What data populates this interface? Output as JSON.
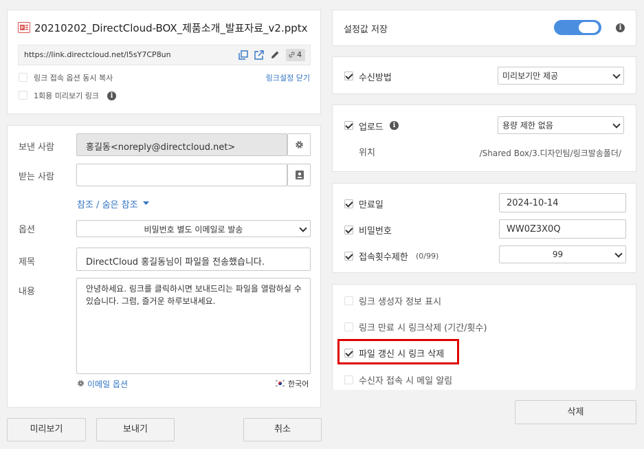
{
  "file": {
    "name": "20210202_DirectCloud-BOX_제품소개_발표자료_v2.pptx",
    "icon": "pptx-file-icon",
    "link_url": "https://link.directcloud.net/l5sY7CP8un",
    "link_count": "4",
    "copy_with_options_label": "링크 접속 옵션 동시 복사",
    "close_link_settings_label": "링크설정 닫기",
    "one_time_preview_label": "1회용 미리보기 링크"
  },
  "mail": {
    "sender_label": "보낸 사람",
    "sender_value": "홍길동<noreply@directcloud.net>",
    "recipient_label": "받는 사람",
    "recipient_value": "",
    "cc_bcc_label": "참조 / 숨은 참조",
    "option_label": "옵션",
    "option_value": "비밀번호 별도 이메일로 발송",
    "subject_label": "제목",
    "subject_value": "DirectCloud 홍길동님이 파일을 전송했습니다.",
    "body_label": "내용",
    "body_value": "안녕하세요. 링크를 클릭하시면 보내드리는 파일을 열람하실 수 있습니다. 그럼, 즐거운 하루보내세요.",
    "email_options_label": "이메일 옵션",
    "language_label": "한국어"
  },
  "buttons": {
    "preview": "미리보기",
    "send": "보내기",
    "cancel": "취소",
    "delete": "삭제"
  },
  "settings": {
    "save_label": "설정값 저장",
    "save_toggle_on": true,
    "receive_method_label": "수신방법",
    "receive_method_value": "미리보기만 제공",
    "upload_label": "업로드",
    "upload_value": "용량 제한 없음",
    "location_label": "위치",
    "location_value": "/Shared Box/3.디자인팀/링크발송폴더/",
    "expiry_label": "만료일",
    "expiry_value": "2024-10-14",
    "password_label": "비밀번호",
    "password_value": "WW0Z3X0Q",
    "access_limit_label": "접속횟수제한",
    "access_limit_count": "(0/99)",
    "access_limit_value": "99",
    "show_creator_label": "링크 생성자 정보 표시",
    "delete_on_expire_label": "링크 만료 시 링크삭제 (기간/횟수)",
    "delete_on_update_label": "파일 갱신 시 링크 삭제",
    "notify_on_access_label": "수신자 접속 시 메일 알림"
  },
  "colors": {
    "accent": "#2f73c4",
    "toggle": "#4a8ee0",
    "highlight_border": "#e00000"
  }
}
